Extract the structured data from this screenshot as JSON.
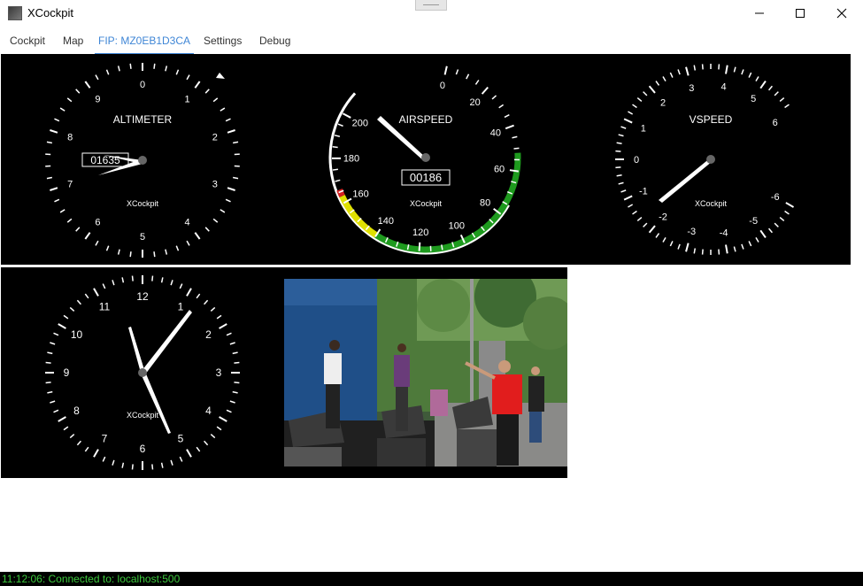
{
  "window": {
    "title": "XCockpit"
  },
  "tabs": [
    {
      "label": "Cockpit"
    },
    {
      "label": "Map"
    },
    {
      "label": "FIP: MZ0EB1D3CA"
    },
    {
      "label": "Settings"
    },
    {
      "label": "Debug"
    }
  ],
  "active_tab": "FIP: MZ0EB1D3CA",
  "gauges": {
    "altimeter": {
      "title": "ALTIMETER",
      "brand": "XCockpit",
      "digits": "01635",
      "dial": [
        "0",
        "1",
        "2",
        "3",
        "4",
        "5",
        "6",
        "7",
        "8",
        "9"
      ]
    },
    "airspeed": {
      "title": "AIRSPEED",
      "brand": "XCockpit",
      "digits": "00186",
      "labels": [
        "0",
        "20",
        "40",
        "60",
        "80",
        "100",
        "120",
        "140",
        "160",
        "180",
        "200"
      ]
    },
    "vspeed": {
      "title": "VSPEED",
      "brand": "XCockpit",
      "labels": [
        "0",
        "1",
        "2",
        "3",
        "4",
        "5",
        "6",
        "-6",
        "-5",
        "-4",
        "-3",
        "-2",
        "-1"
      ]
    },
    "clock": {
      "brand": "XCockpit",
      "dial": [
        "12",
        "1",
        "2",
        "3",
        "4",
        "5",
        "6",
        "7",
        "8",
        "9",
        "10",
        "11"
      ]
    }
  },
  "status": {
    "text": "11:12:06: Connected to: localhost:500"
  },
  "colors": {
    "accent": "#3f86d6",
    "status_text": "#3dc93d",
    "panel_bg": "#000000",
    "arc_green": "#1e9a1e",
    "arc_yellow": "#e0e000",
    "arc_red": "#d42020"
  }
}
